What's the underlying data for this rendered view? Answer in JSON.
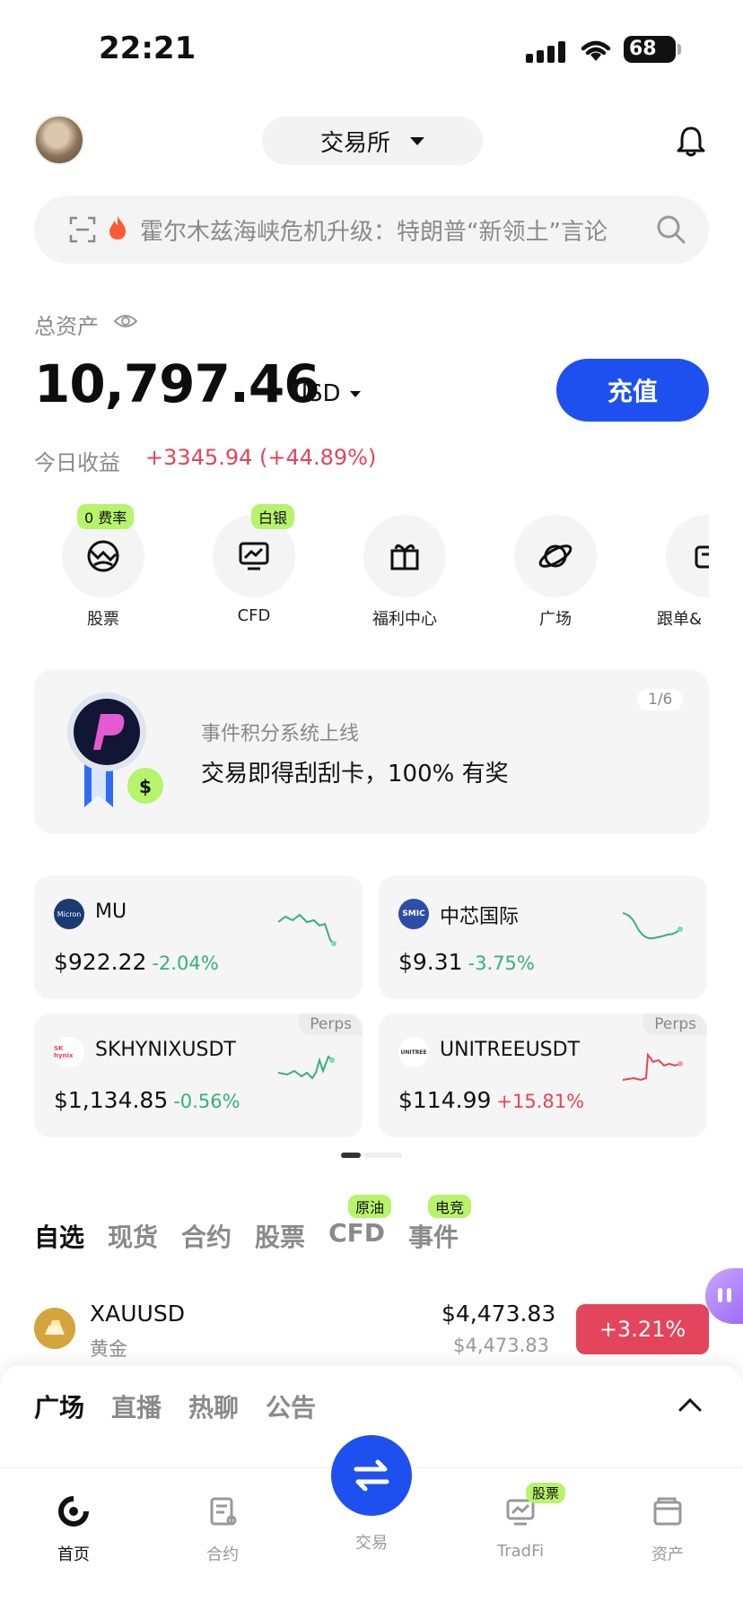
{
  "status_bar": {
    "time": "22:21",
    "battery": "68"
  },
  "header": {
    "exchange_label": "交易所"
  },
  "search": {
    "headline": "霍尔木兹海峡危机升级：特朗普“新领土”言论"
  },
  "assets": {
    "label": "总资产",
    "balance": "10,797.46",
    "currency": "USD",
    "deposit_label": "充值",
    "pnl_label": "今日收益",
    "pnl_value": "+3345.94 (+44.89%)"
  },
  "quick_entries": [
    {
      "label": "股票",
      "tag": "0 费率",
      "icon": "globe-icon"
    },
    {
      "label": "CFD",
      "tag": "白银",
      "icon": "chart-monitor-icon"
    },
    {
      "label": "福利中心",
      "tag": "",
      "icon": "gift-icon"
    },
    {
      "label": "广场",
      "tag": "",
      "icon": "planet-icon"
    },
    {
      "label": "跟单&",
      "tag": "",
      "icon": "copy-trade-icon"
    }
  ],
  "banner": {
    "subtitle": "事件积分系统上线",
    "title": "交易即得刮刮卡，100% 有奖",
    "page": "1/6",
    "badge_symbol": "$"
  },
  "tickers": [
    {
      "symbol": "MU",
      "price": "$922.22",
      "change": "-2.04%",
      "direction": "down",
      "perps": "",
      "logo_text": "Micron",
      "logo_color": "#1b3a73"
    },
    {
      "symbol": "中芯国际",
      "price": "$9.31",
      "change": "-3.75%",
      "direction": "down",
      "perps": "",
      "logo_text": "SMIC",
      "logo_color": "#2d4da8"
    },
    {
      "symbol": "SKHYNIXUSDT",
      "price": "$1,134.85",
      "change": "-0.56%",
      "direction": "down",
      "perps": "Perps",
      "logo_text": "SK hynix",
      "logo_color": "#ffffff"
    },
    {
      "symbol": "UNITREEUSDT",
      "price": "$114.99",
      "change": "+15.81%",
      "direction": "up",
      "perps": "Perps",
      "logo_text": "UNITREE",
      "logo_color": "#ffffff"
    }
  ],
  "market_tabs": [
    {
      "label": "自选",
      "tag": "",
      "active": true
    },
    {
      "label": "现货",
      "tag": ""
    },
    {
      "label": "合约",
      "tag": ""
    },
    {
      "label": "股票",
      "tag": ""
    },
    {
      "label": "CFD",
      "tag": "原油"
    },
    {
      "label": "事件",
      "tag": "电竞"
    }
  ],
  "watchlist": [
    {
      "symbol": "XAUUSD",
      "name": "黄金",
      "price": "$4,473.83",
      "sub_price": "$4,473.83",
      "change": "+3.21%"
    }
  ],
  "social_tabs": [
    "广场",
    "直播",
    "热聊",
    "公告"
  ],
  "nav": {
    "items": [
      "首页",
      "合约",
      "交易",
      "TradFi",
      "资产"
    ],
    "tradfi_tag": "股票"
  },
  "colors": {
    "accent": "#1e50f0",
    "up": "#e2455c",
    "down": "#37b07a",
    "tag": "#b7f36b"
  }
}
